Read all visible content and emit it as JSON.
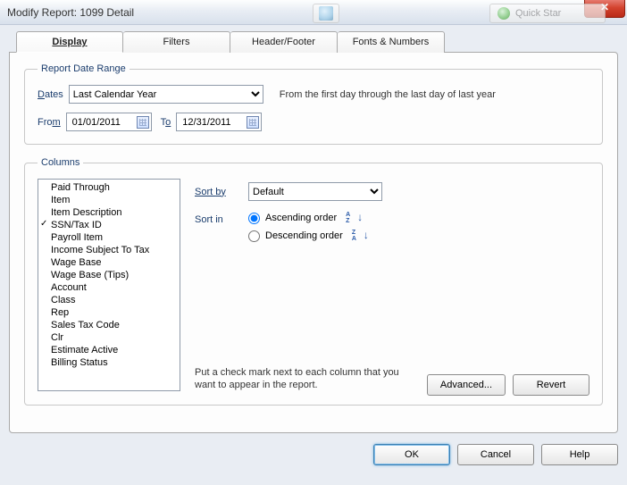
{
  "window": {
    "title": "Modify Report: 1099 Detail"
  },
  "bg": {
    "label1": "",
    "label2": "Quick Star"
  },
  "tabs": [
    "Display",
    "Filters",
    "Header/Footer",
    "Fonts & Numbers"
  ],
  "active_tab": 0,
  "date_range": {
    "legend": "Report Date Range",
    "dates_label": "Dates",
    "preset": "Last Calendar Year",
    "hint": "From the first day through the last day of last year",
    "from_label": "From",
    "from_value": "01/01/2011",
    "to_label": "To",
    "to_value": "12/31/2011"
  },
  "columns": {
    "legend": "Columns",
    "items": [
      {
        "label": "Paid Through",
        "checked": false
      },
      {
        "label": "Item",
        "checked": false
      },
      {
        "label": "Item Description",
        "checked": false
      },
      {
        "label": "SSN/Tax ID",
        "checked": true
      },
      {
        "label": "Payroll Item",
        "checked": false
      },
      {
        "label": "Income Subject To Tax",
        "checked": false
      },
      {
        "label": "Wage Base",
        "checked": false
      },
      {
        "label": "Wage Base (Tips)",
        "checked": false
      },
      {
        "label": "Account",
        "checked": false
      },
      {
        "label": "Class",
        "checked": false
      },
      {
        "label": "Rep",
        "checked": false
      },
      {
        "label": "Sales Tax Code",
        "checked": false
      },
      {
        "label": "Clr",
        "checked": false
      },
      {
        "label": "Estimate Active",
        "checked": false
      },
      {
        "label": "Billing Status",
        "checked": false
      }
    ],
    "sort_by_label": "Sort by",
    "sort_by_value": "Default",
    "sort_in_label": "Sort in",
    "asc_label": "Ascending order",
    "desc_label": "Descending order",
    "sort_selected": "asc",
    "hint": "Put a check mark next to each column that you want to appear in the report.",
    "advanced": "Advanced...",
    "revert": "Revert"
  },
  "buttons": {
    "ok": "OK",
    "cancel": "Cancel",
    "help": "Help"
  }
}
